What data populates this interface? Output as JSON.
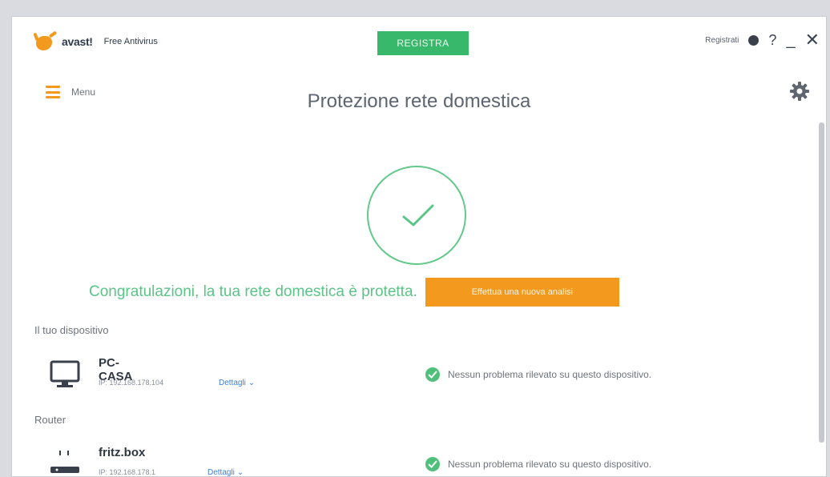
{
  "app": {
    "brand": "avast!",
    "product": "Free Antivirus",
    "register_button": "REGISTRA",
    "top_register_link": "Registrati"
  },
  "nav": {
    "menu_label": "Menu"
  },
  "page": {
    "title": "Protezione rete domestica",
    "status_message": "Congratulazioni, la tua rete domestica è protetta.",
    "scan_button": "Effettua una nuova analisi"
  },
  "sections": {
    "your_device": "Il tuo dispositivo",
    "router": "Router"
  },
  "devices": [
    {
      "name": "PC-CASA",
      "ip": "IP: 192.168.178.104",
      "details": "Dettagli",
      "status": "Nessun problema rilevato su questo dispositivo.",
      "icon": "monitor-icon"
    },
    {
      "name": "fritz.box",
      "ip": "IP: 192.168.178.1",
      "details": "Dettagli",
      "status": "Nessun problema rilevato su questo dispositivo.",
      "icon": "router-icon"
    }
  ],
  "colors": {
    "accent_orange": "#f39a1e",
    "success_green": "#5bc487",
    "register_green": "#37b86a",
    "link_blue": "#3d7fd1"
  }
}
